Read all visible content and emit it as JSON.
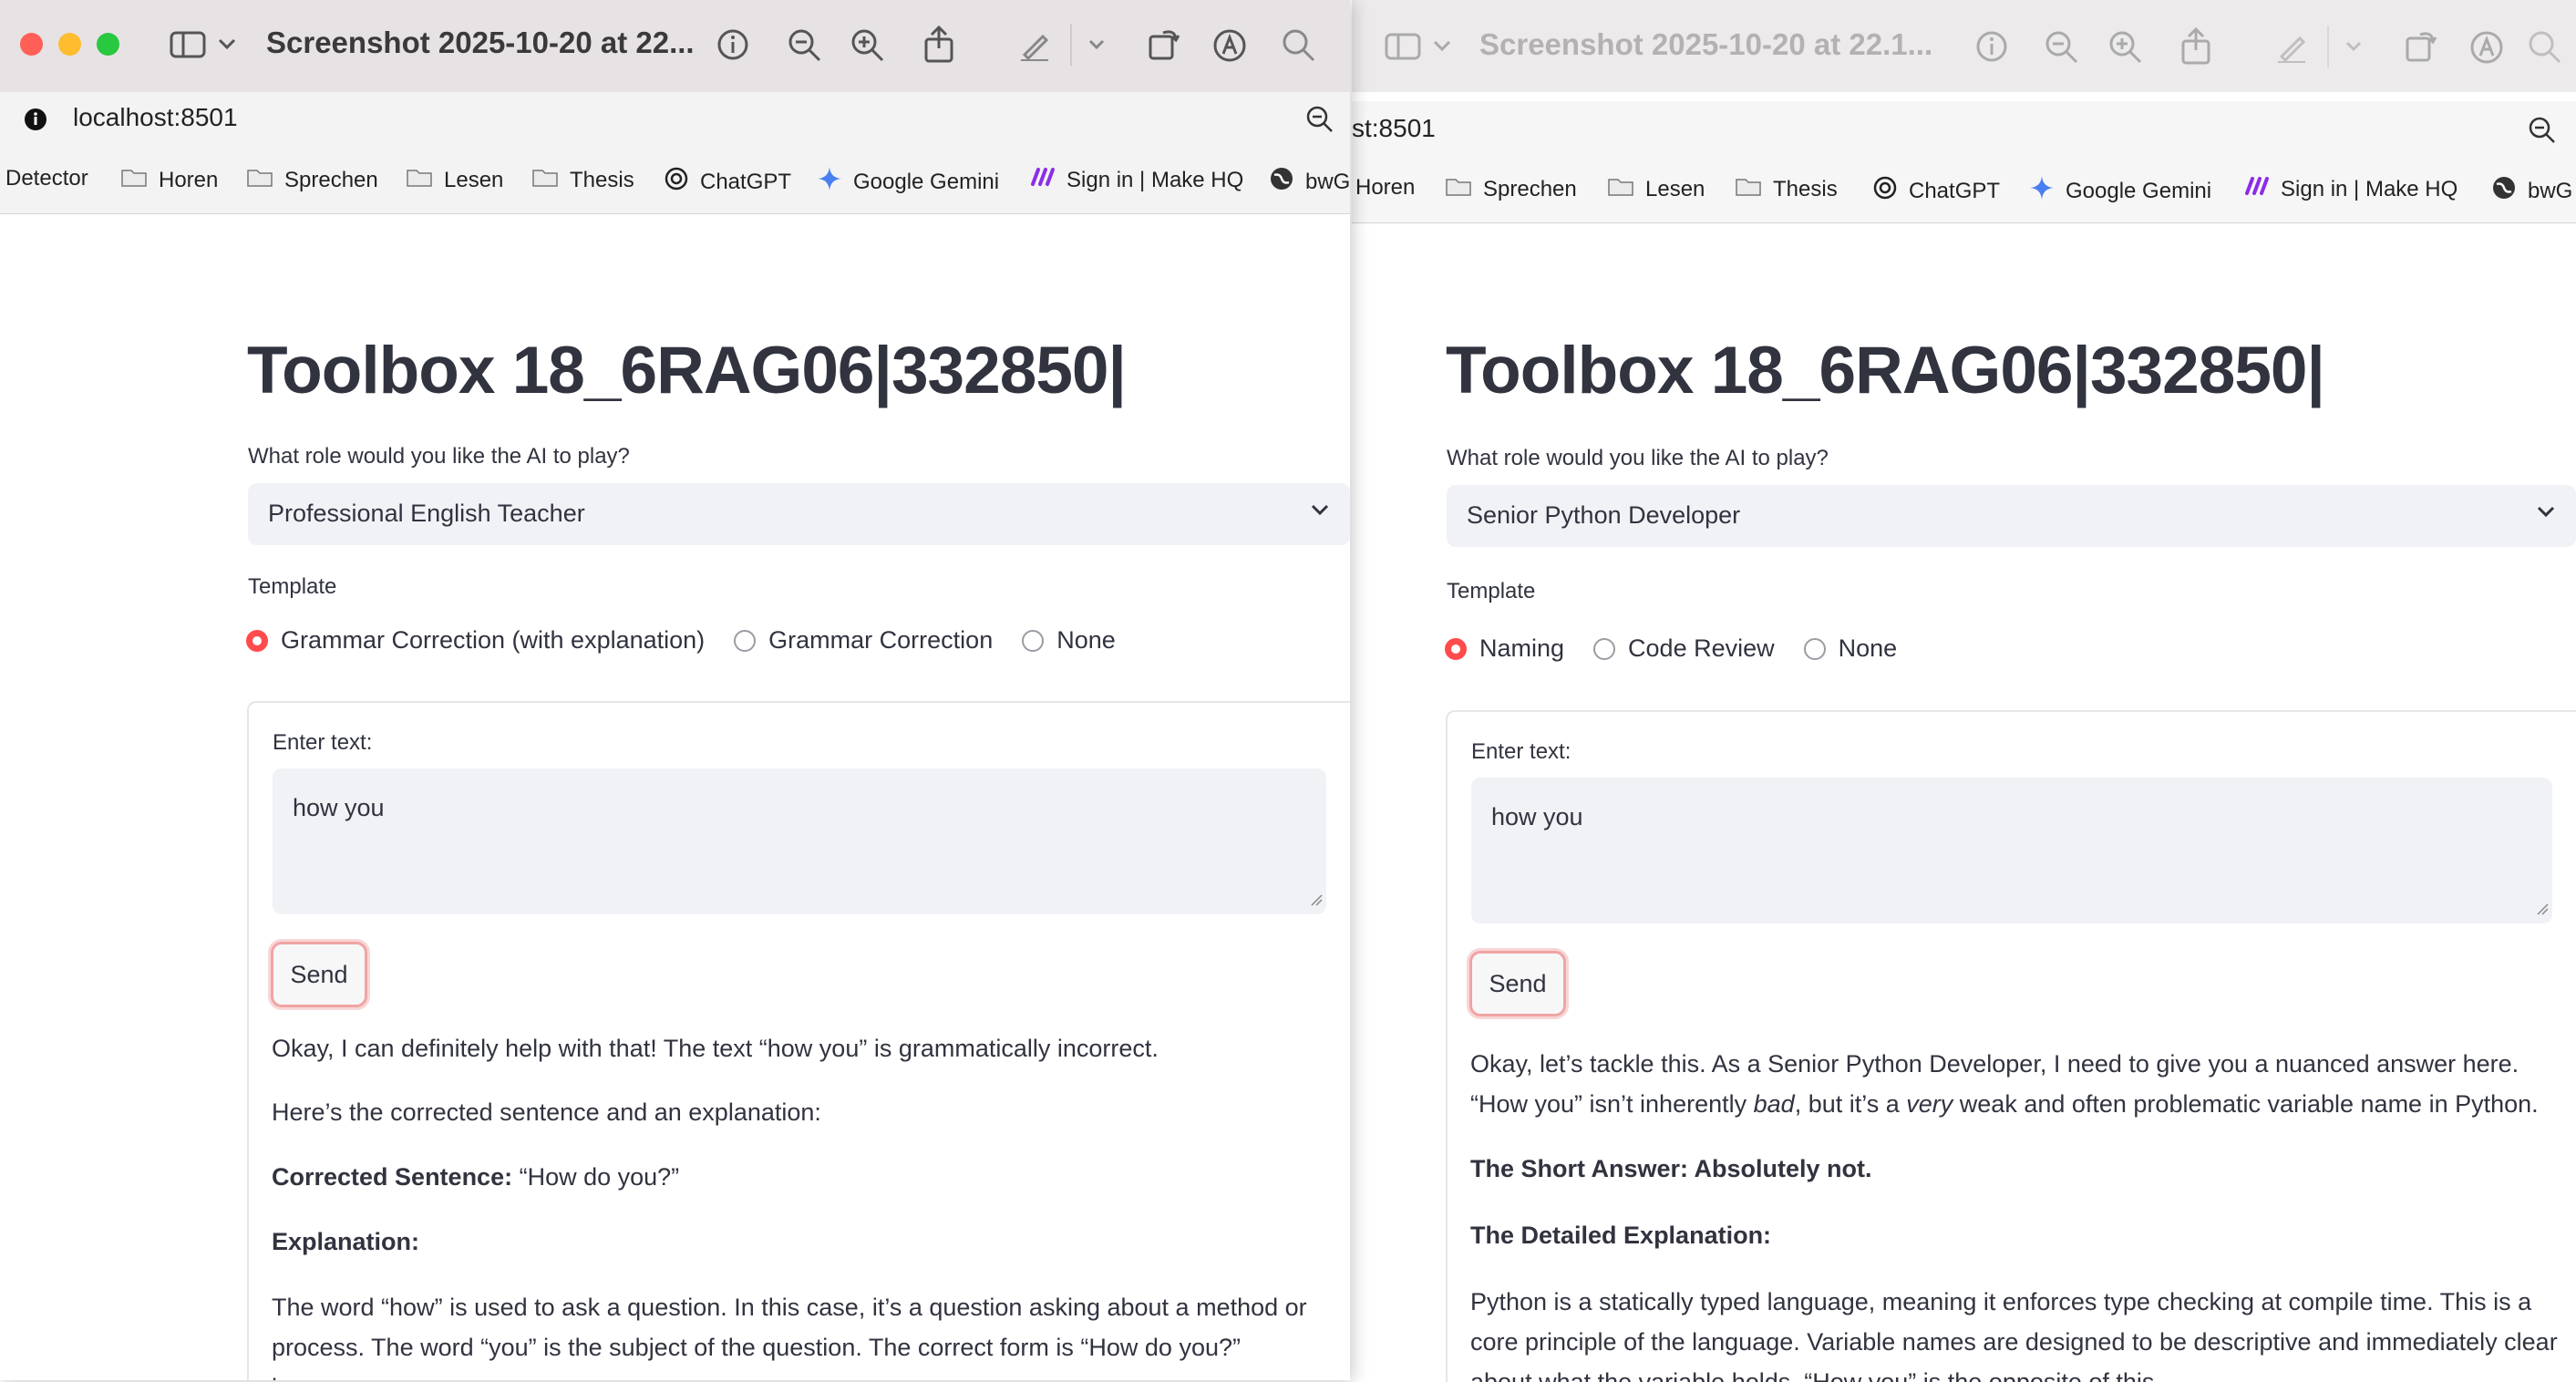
{
  "left": {
    "titlebar": {
      "title": "Screenshot 2025-10-20 at 22..."
    },
    "url": "localhost:8501",
    "bookmarks": [
      "Detector",
      "Horen",
      "Sprechen",
      "Lesen",
      "Thesis",
      "ChatGPT",
      "Google Gemini",
      "Sign in | Make HQ",
      "bwG"
    ],
    "page": {
      "title": "Toolbox 18_6RAG06|332850|",
      "role_label": "What role would you like the AI to play?",
      "role_value": "Professional English Teacher",
      "template_label": "Template",
      "template_options": [
        "Grammar Correction (with explanation)",
        "Grammar Correction",
        "None"
      ],
      "selected_option": 0,
      "input_label": "Enter text:",
      "input_value": "how you",
      "send_label": "Send",
      "response": {
        "p1": "Okay, I can definitely help with that! The text “how you” is grammatically incorrect.",
        "p2": "Here’s the corrected sentence and an explanation:",
        "p3_bold": "Corrected Sentence:",
        "p3_rest": " “How do you?”",
        "p4_bold": "Explanation:",
        "p5": "The word “how” is used to ask a question. In this case, it’s a question asking about a method or process. The word “you” is the subject of the question. The correct form is “How do you?” because"
      }
    }
  },
  "right": {
    "titlebar": {
      "title": "Screenshot 2025-10-20 at 22.1..."
    },
    "url": "st:8501",
    "bookmarks": [
      "Horen",
      "Sprechen",
      "Lesen",
      "Thesis",
      "ChatGPT",
      "Google Gemini",
      "Sign in | Make HQ",
      "bwG"
    ],
    "page": {
      "title": "Toolbox 18_6RAG06|332850|",
      "role_label": "What role would you like the AI to play?",
      "role_value": "Senior Python Developer",
      "template_label": "Template",
      "template_options": [
        "Naming",
        "Code Review",
        "None"
      ],
      "selected_option": 0,
      "input_label": "Enter text:",
      "input_value": "how you",
      "send_label": "Send",
      "response": {
        "p1a": "Okay, let’s tackle this. As a Senior Python Developer, I need to give you a nuanced answer here. “How you” isn’t inherently ",
        "p1b": "bad",
        "p1c": ", but it’s a ",
        "p1d": "very",
        "p1e": " weak and often problematic variable name in Python.",
        "p2": "The Short Answer: Absolutely not.",
        "p3": "The Detailed Explanation:",
        "p4": "Python is a statically typed language, meaning it enforces type checking at compile time. This is a core principle of the language. Variable names are designed to be descriptive and immediately clear about what the variable holds. “How you” is the opposite of this."
      }
    }
  },
  "colors": {
    "accent": "#ff4b4b",
    "text": "#31333f",
    "input_bg": "#f0f2f6"
  }
}
